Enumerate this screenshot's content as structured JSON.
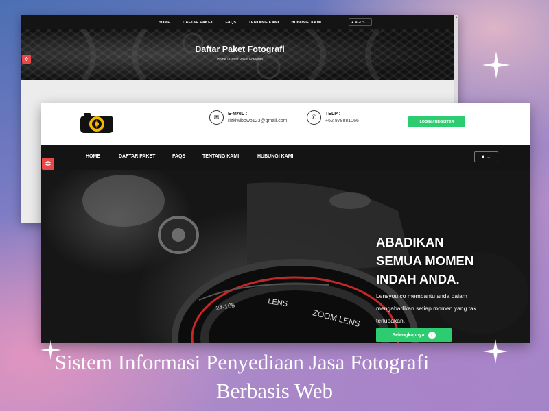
{
  "back_window": {
    "nav": [
      "HOME",
      "DAFTAR PAKET",
      "FAQS",
      "TENTANG KAMI",
      "HUBUNGI KAMI"
    ],
    "account_label": "AGUS",
    "page_title": "Daftar Paket Fotografi",
    "breadcrumb": "Home  ›  Daftar Paket Fotografi"
  },
  "front_window": {
    "email": {
      "label": "E-MAIL :",
      "value": "rizkiwibowo123@gmail.com"
    },
    "phone": {
      "label": "TELP :",
      "value": "+62 878881066"
    },
    "login_label": "LOGIN / REGISTER",
    "nav": [
      "HOME",
      "DAFTAR PAKET",
      "FAQS",
      "TENTANG KAMI",
      "HUBUNGI KAMI"
    ],
    "hero": {
      "heading_lines": [
        "ABADIKAN",
        "SEMUA MOMEN",
        "INDAH ANDA."
      ],
      "description": "Lensyou.co membantu anda dalam mengabadikan setiap momen yang tak terlupakan.",
      "cta_label": "Selengkapnya"
    },
    "lens_text": {
      "brand": "LENS",
      "zoom": "ZOOM LENS",
      "focal": "24-105"
    }
  },
  "caption": {
    "line1": "Sistem Informasi Penyediaan Jasa Fotografi",
    "line2": "Berbasis Web"
  },
  "colors": {
    "accent_green": "#2ecc71",
    "gear_red": "#e84848",
    "nav_dark": "#141414"
  },
  "icons": [
    "gear-icon",
    "camera-logo-icon",
    "envelope-icon",
    "phone-icon",
    "user-icon",
    "chevron-down-icon",
    "arrow-right-icon",
    "sparkle-icon"
  ]
}
